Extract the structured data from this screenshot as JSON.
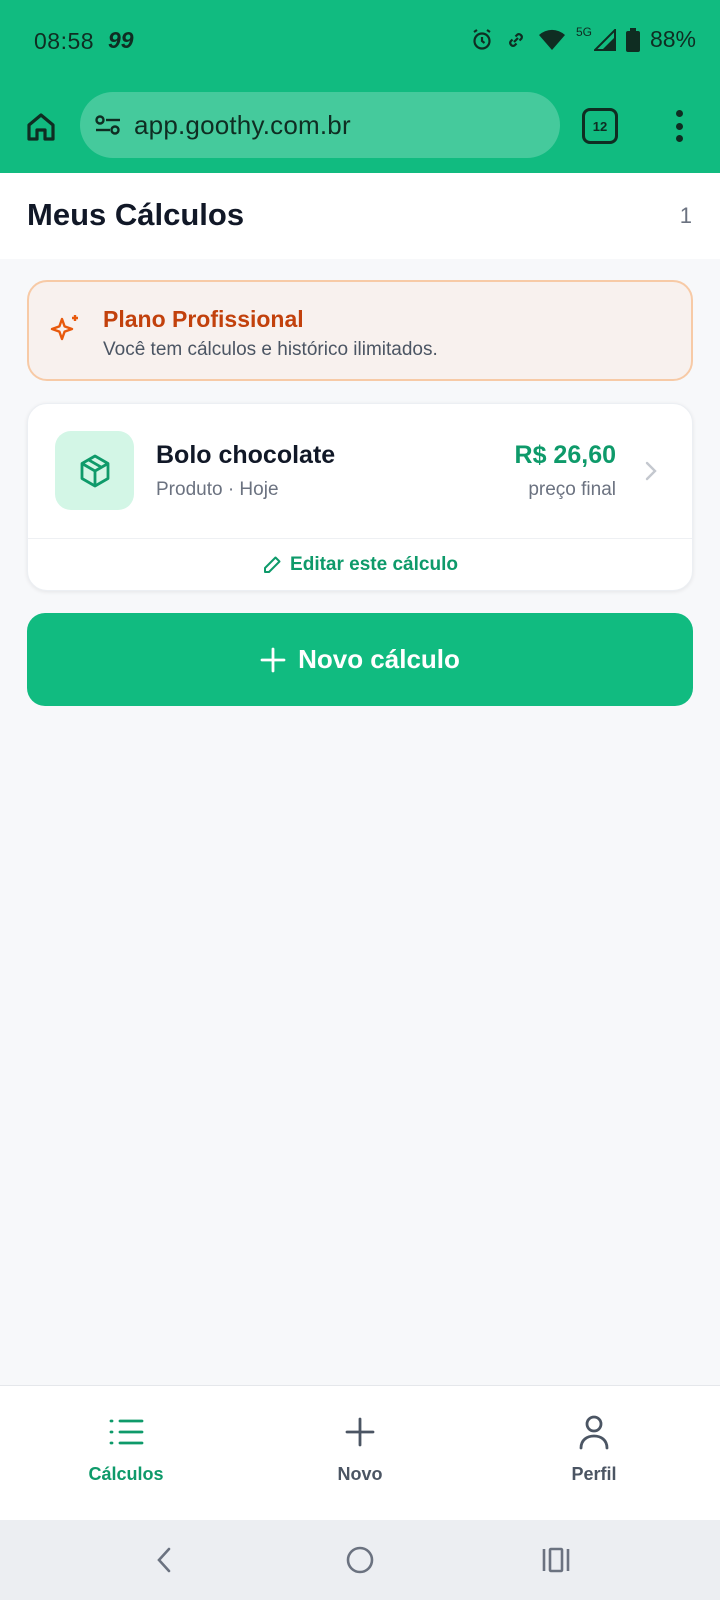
{
  "status_bar": {
    "time": "08:58",
    "notification": "99",
    "network": "5G",
    "battery": "88%"
  },
  "browser": {
    "url": "app.goothy.com.br",
    "tab_count": "12"
  },
  "header": {
    "title": "Meus Cálculos",
    "count": "1"
  },
  "plan_banner": {
    "title": "Plano Profissional",
    "subtitle": "Você tem cálculos e histórico ilimitados.",
    "icon": "sparkle-icon",
    "accent": "#c2410c"
  },
  "calculations": [
    {
      "name": "Bolo chocolate",
      "meta": "Produto · Hoje",
      "price": "R$ 26,60",
      "price_label": "preço final",
      "icon": "package-icon",
      "edit_label": "Editar este cálculo"
    }
  ],
  "new_button": {
    "label": "Novo cálculo"
  },
  "bottom_nav": {
    "items": [
      {
        "label": "Cálculos",
        "icon": "list-icon",
        "active": true
      },
      {
        "label": "Novo",
        "icon": "plus-icon",
        "active": false
      },
      {
        "label": "Perfil",
        "icon": "user-icon",
        "active": false
      }
    ]
  },
  "colors": {
    "brand": "#11bb80",
    "accent_green": "#0e9a6a",
    "plan_bg": "#f8f1ee",
    "plan_border": "#f7caa6"
  }
}
